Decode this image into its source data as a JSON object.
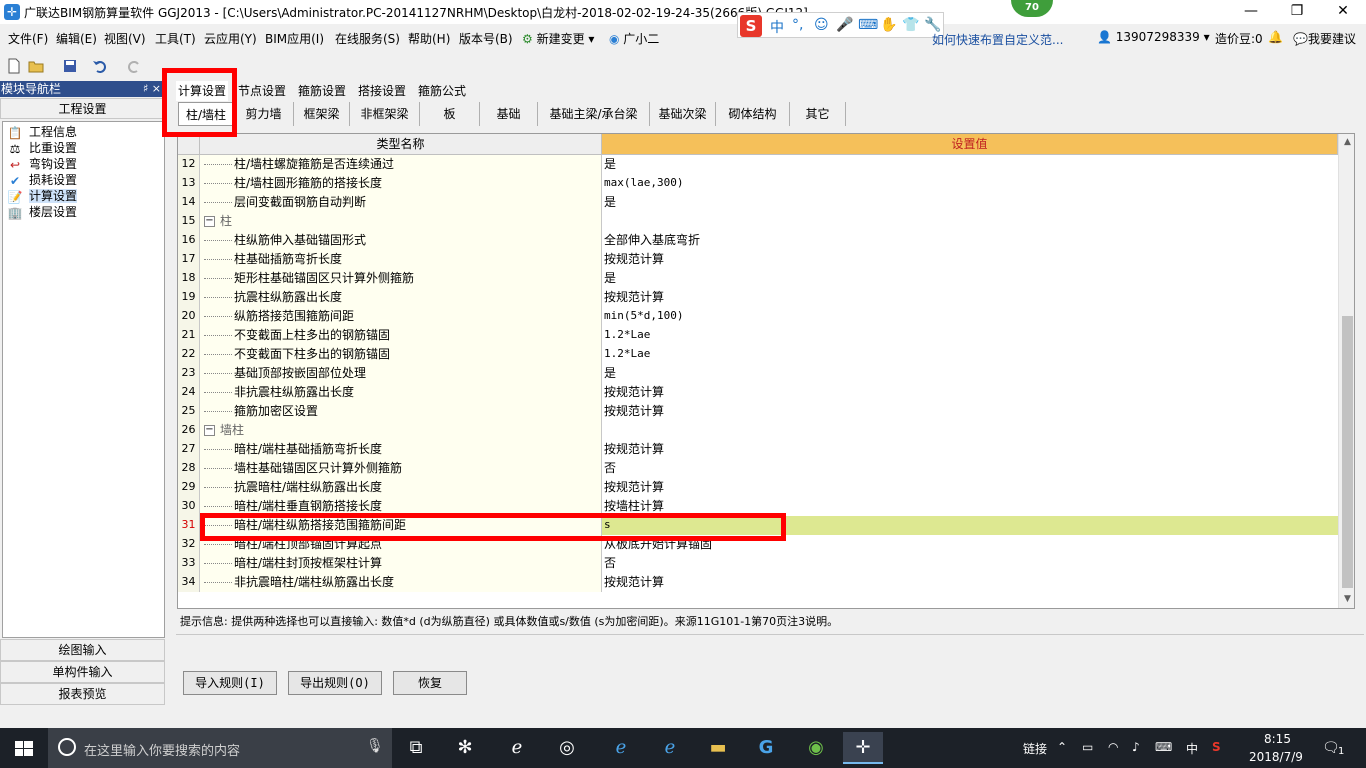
{
  "window": {
    "title": "广联达BIM钢筋算量软件 GGJ2013 - [C:\\Users\\Administrator.PC-20141127NRHM\\Desktop\\白龙村-2018-02-02-19-24-35(2666版).GGJ12]",
    "minimize": "—",
    "restore": "❐",
    "close": "✕",
    "score_badge": "70"
  },
  "ime": {
    "items": [
      "中",
      "°,",
      "☺",
      "🎤",
      "⌨",
      "✋",
      "👕",
      "🔧"
    ]
  },
  "menu": {
    "items": [
      "文件(F)",
      "编辑(E)",
      "视图(V)",
      "工具(T)",
      "云应用(Y)",
      "BIM应用(I)",
      "在线服务(S)",
      "帮助(H)",
      "版本号(B)",
      "新建变更 ▾",
      "广小二"
    ],
    "tip_link": "如何快速布置自定义范...",
    "phone": "13907298339 ▾",
    "price_beans": "造价豆:0",
    "suggest": "我要建议"
  },
  "nav": {
    "header": "模块导航栏",
    "pins": "♯ ×",
    "section": "工程设置",
    "items": [
      {
        "label": "工程信息",
        "icon": "📋"
      },
      {
        "label": "比重设置",
        "icon": "⚖"
      },
      {
        "label": "弯钩设置",
        "icon": "↩"
      },
      {
        "label": "损耗设置",
        "icon": "✔"
      },
      {
        "label": "计算设置",
        "icon": "📝"
      },
      {
        "label": "楼层设置",
        "icon": "🏢"
      }
    ],
    "bottom": [
      "绘图输入",
      "单构件输入",
      "报表预览"
    ]
  },
  "top_tabs": [
    "计算设置",
    "节点设置",
    "箍筋设置",
    "搭接设置",
    "箍筋公式"
  ],
  "sub_tabs": [
    "柱/墙柱",
    "剪力墙",
    "框架梁",
    "非框架梁",
    "板",
    "基础",
    "基础主梁/承台梁",
    "基础次梁",
    "砌体结构",
    "其它"
  ],
  "grid": {
    "col_name": "类型名称",
    "col_value": "设置值",
    "rows": [
      {
        "n": "12",
        "name": "柱/墙柱螺旋箍筋是否连续通过",
        "value": "是"
      },
      {
        "n": "13",
        "name": "柱/墙柱圆形箍筋的搭接长度",
        "value": "max(lae,300)",
        "mono": true
      },
      {
        "n": "14",
        "name": "层间变截面钢筋自动判断",
        "value": "是"
      },
      {
        "n": "15",
        "name": "柱",
        "value": "",
        "group": true
      },
      {
        "n": "16",
        "name": "柱纵筋伸入基础锚固形式",
        "value": "全部伸入基底弯折"
      },
      {
        "n": "17",
        "name": "柱基础插筋弯折长度",
        "value": "按规范计算"
      },
      {
        "n": "18",
        "name": "矩形柱基础锚固区只计算外侧箍筋",
        "value": "是"
      },
      {
        "n": "19",
        "name": "抗震柱纵筋露出长度",
        "value": "按规范计算"
      },
      {
        "n": "20",
        "name": "纵筋搭接范围箍筋间距",
        "value": "min(5*d,100)",
        "mono": true
      },
      {
        "n": "21",
        "name": "不变截面上柱多出的钢筋锚固",
        "value": "1.2*Lae",
        "mono": true
      },
      {
        "n": "22",
        "name": "不变截面下柱多出的钢筋锚固",
        "value": "1.2*Lae",
        "mono": true
      },
      {
        "n": "23",
        "name": "基础顶部按嵌固部位处理",
        "value": "是"
      },
      {
        "n": "24",
        "name": "非抗震柱纵筋露出长度",
        "value": "按规范计算"
      },
      {
        "n": "25",
        "name": "箍筋加密区设置",
        "value": "按规范计算"
      },
      {
        "n": "26",
        "name": "墙柱",
        "value": "",
        "group": true
      },
      {
        "n": "27",
        "name": "暗柱/端柱基础插筋弯折长度",
        "value": "按规范计算"
      },
      {
        "n": "28",
        "name": "墙柱基础锚固区只计算外侧箍筋",
        "value": "否"
      },
      {
        "n": "29",
        "name": "抗震暗柱/端柱纵筋露出长度",
        "value": "按规范计算"
      },
      {
        "n": "30",
        "name": "暗柱/端柱垂直钢筋搭接长度",
        "value": "按墙柱计算"
      },
      {
        "n": "31",
        "name": "暗柱/端柱纵筋搭接范围箍筋间距",
        "value": "s",
        "mono": true,
        "highlight": true
      },
      {
        "n": "32",
        "name": "暗柱/端柱顶部锚固计算起点",
        "value": "从板底开始计算锚固"
      },
      {
        "n": "33",
        "name": "暗柱/端柱封顶按框架柱计算",
        "value": "否"
      },
      {
        "n": "34",
        "name": "非抗震暗柱/端柱纵筋露出长度",
        "value": "按规范计算"
      }
    ]
  },
  "hint": "提示信息: 提供两种选择也可以直接输入: 数值*d (d为纵筋直径) 或具体数值或s/数值 (s为加密间距)。来源11G101-1第70页注3说明。",
  "buttons": {
    "import": "导入规则(I)",
    "export": "导出规则(O)",
    "restore": "恢复"
  },
  "taskbar": {
    "search_placeholder": "在这里输入你要搜索的内容",
    "link": "链接",
    "lang": "中",
    "time": "8:15",
    "date": "2018/7/9",
    "notifications": "1"
  },
  "colors": {
    "header_orange": "#f5c05a",
    "highlight_row": "#dde891",
    "annotation_red": "#ff0000",
    "nav_header": "#2e4e8c"
  }
}
